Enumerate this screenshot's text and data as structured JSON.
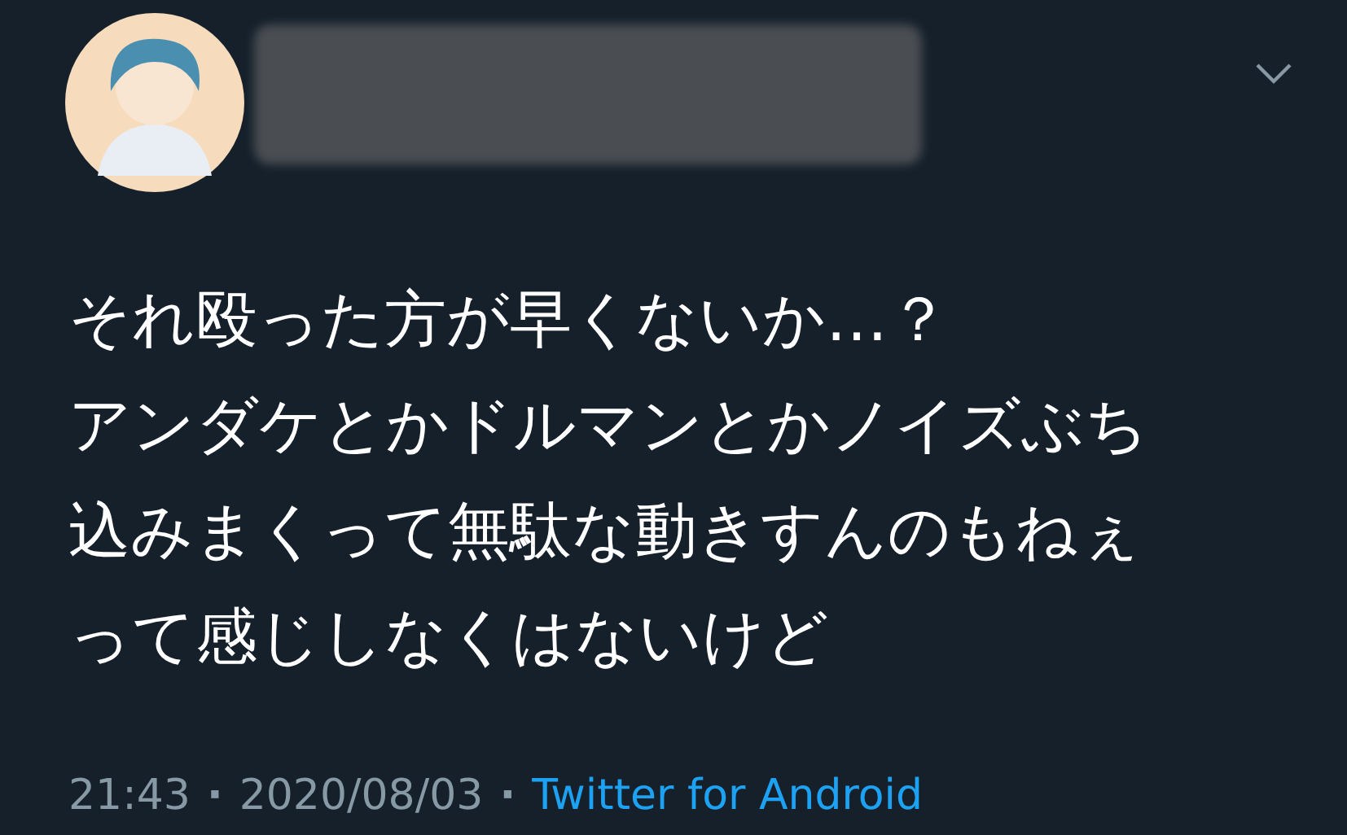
{
  "tweet_lines": [
    "それ殴った方が早くないか…？",
    "アンダケとかドルマンとかノイズぶち",
    "込みまくって無駄な動きすんのもねぇ",
    "って感じしなくはないけど"
  ],
  "footer": [
    {
      "kind": "text",
      "text": "21:43"
    },
    {
      "kind": "separator",
      "text": "·"
    },
    {
      "kind": "text",
      "text": "2020/08/03"
    },
    {
      "kind": "separator",
      "text": "·"
    },
    {
      "kind": "link",
      "text": "Twitter for Android"
    }
  ]
}
